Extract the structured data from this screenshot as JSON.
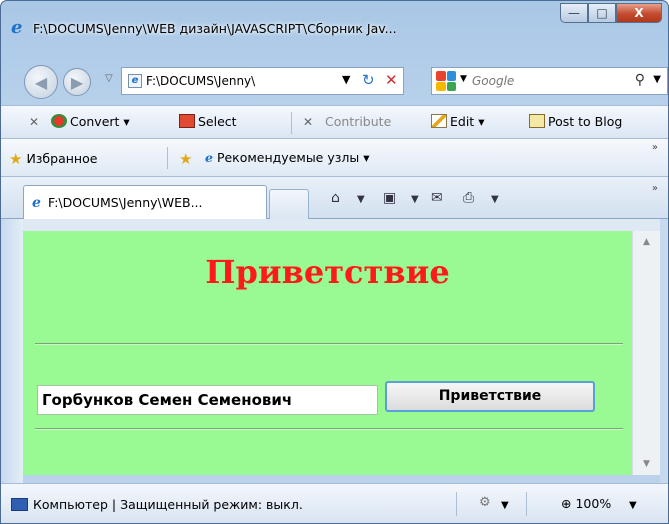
{
  "window": {
    "title": "F:\\DOCUMS\\Jenny\\WEB дизайн\\JAVASCRIPT\\Сборник Jav...",
    "minimize_glyph": "—",
    "maximize_glyph": "□",
    "close_glyph": "X"
  },
  "navigation": {
    "address": "F:\\DOCUMS\\Jenny\\",
    "search_placeholder": "Google",
    "back_glyph": "◀",
    "forward_glyph": "▶",
    "refresh_glyph": "↻",
    "stop_glyph": "✕",
    "search_glyph": "⚲"
  },
  "command_bar": {
    "convert_label": "Convert",
    "select_label": "Select",
    "contribute_label": "Contribute",
    "edit_label": "Edit",
    "post_label": "Post to Blog",
    "close_glyph": "✕"
  },
  "favorites_bar": {
    "favorites_label": "Избранное",
    "suggested_label": "Рекомендуемые узлы ▾",
    "more_glyph": "»"
  },
  "tabs": [
    {
      "label": "F:\\DOCUMS\\Jenny\\WEB...",
      "active": true
    }
  ],
  "tab_tools": {
    "home_icon": "home-icon",
    "feeds_icon": "feeds-icon",
    "mail_icon": "mail-icon",
    "print_icon": "print-icon",
    "more_glyph": "»"
  },
  "page": {
    "background": "#99f993",
    "heading": "Приветствие",
    "heading_color": "#ff1a1a",
    "name_value": "Горбунков Семен Семенович",
    "greet_button_label": "Приветствие"
  },
  "status_bar": {
    "zone_text": "Компьютер | Защищенный режим: выкл.",
    "zoom_label": "100%"
  }
}
